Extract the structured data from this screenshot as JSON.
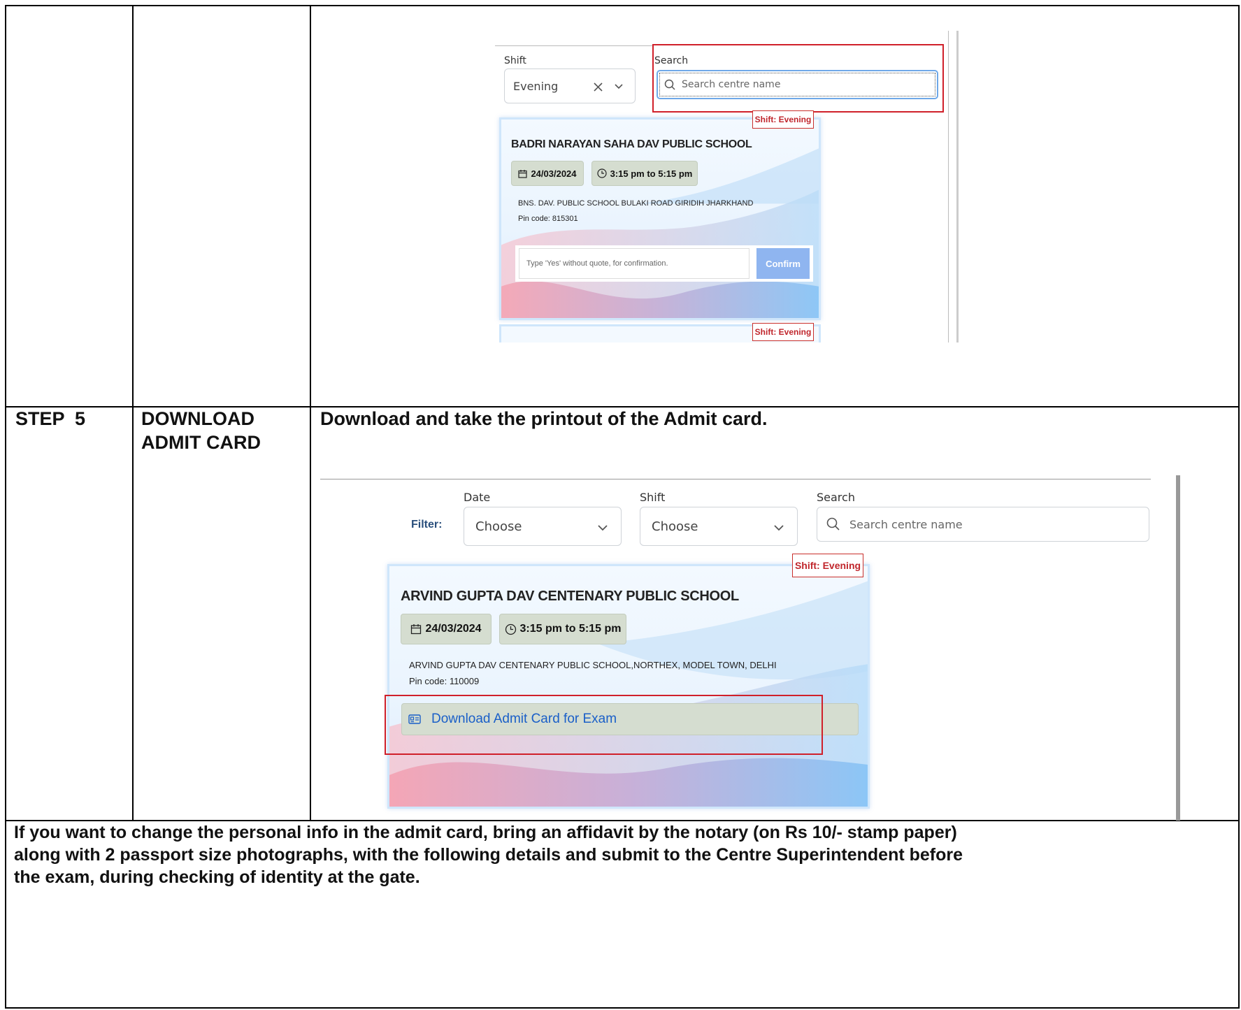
{
  "top_section": {
    "shift_label": "Shift",
    "shift_value": "Evening",
    "clear_icon": "close-icon",
    "chevron_icon": "chevron-down-icon",
    "search_label": "Search",
    "search_placeholder": "Search centre name",
    "card": {
      "badge": "Shift: Evening",
      "title": "BADRI NARAYAN SAHA DAV PUBLIC SCHOOL",
      "date": "24/03/2024",
      "time": "3:15 pm to 5:15 pm",
      "address": "BNS. DAV. PUBLIC SCHOOL BULAKI ROAD GIRIDIH JHARKHAND",
      "pin": "Pin code: 815301",
      "confirm_placeholder": "Type 'Yes' without quote, for confirmation.",
      "confirm_button": "Confirm"
    },
    "next_badge": "Shift: Evening"
  },
  "step5": {
    "step": "STEP  5",
    "name_line1": "DOWNLOAD",
    "name_line2": "ADMIT CARD",
    "instruction": "Download and take the printout of the Admit card.",
    "filter_label": "Filter:",
    "date_label": "Date",
    "date_value": "Choose",
    "shift_label": "Shift",
    "shift_value": "Choose",
    "search_label": "Search",
    "search_placeholder": "Search centre name",
    "card": {
      "badge": "Shift: Evening",
      "title": "ARVIND GUPTA DAV CENTENARY PUBLIC SCHOOL",
      "date": "24/03/2024",
      "time": "3:15 pm to 5:15 pm",
      "address": "ARVIND GUPTA DAV CENTENARY PUBLIC SCHOOL,NORTHEX, MODEL TOWN, DELHI",
      "pin": "Pin code: 110009",
      "download_button": "Download Admit Card for Exam"
    }
  },
  "note": {
    "line1": "If you want to change the personal info in the admit card, bring an affidavit by the notary (on Rs 10/- stamp paper)",
    "line2": "along with 2 passport size photographs, with the following details and submit to the Centre Superintendent before",
    "line3": "the exam, during checking of identity at the gate."
  },
  "colors": {
    "highlight_red": "#d0202a",
    "badge_red": "#c0262c",
    "confirm_blue": "#8fb5f0",
    "chip_green": "#d5ddd0",
    "link_blue": "#1a5fc8"
  }
}
